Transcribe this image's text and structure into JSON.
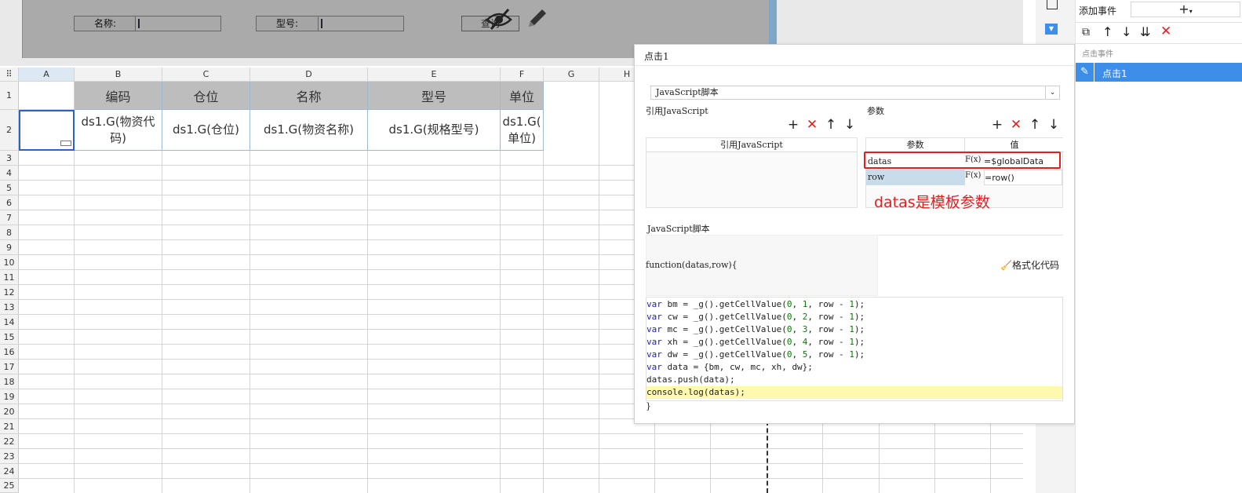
{
  "form": {
    "name_label": "名称:",
    "model_label": "型号:",
    "query_button": "查询"
  },
  "grid": {
    "columns": [
      "A",
      "B",
      "C",
      "D",
      "E",
      "F",
      "G",
      "H"
    ],
    "rows": [
      "1",
      "2",
      "3",
      "4",
      "5",
      "6",
      "7",
      "8",
      "9",
      "10",
      "11",
      "12",
      "13",
      "14",
      "15",
      "16",
      "17",
      "18",
      "19",
      "20",
      "21",
      "22",
      "23",
      "24",
      "25"
    ],
    "header_cells": [
      "编码",
      "仓位",
      "名称",
      "型号",
      "单位"
    ],
    "data_cells": [
      "ds1.G(物资代\n码)",
      "ds1.G(仓位)",
      "ds1.G(物资名称)",
      "ds1.G(规格型号)",
      "ds1.G(\n单位)"
    ]
  },
  "dialog": {
    "title": "点击1",
    "type_select": "JavaScript脚本",
    "ref_js_section": "引用JavaScript",
    "ref_js_column": "引用JavaScript",
    "params_section": "参数",
    "params_col_name": "参数",
    "params_col_value": "值",
    "params": [
      {
        "name": "datas",
        "fx": "F(x)",
        "value": "=$globalData"
      },
      {
        "name": "row",
        "fx": "F(x)",
        "value": "=row()"
      }
    ],
    "annotation": "datas是模板参数",
    "script_section": "JavaScript脚本",
    "function_signature": "function(datas,row){",
    "format_button": "格式化代码",
    "closing_brace": "}",
    "code_lines": [
      "var bm = _g().getCellValue(0, 1, row - 1);",
      "var cw = _g().getCellValue(0, 2, row - 1);",
      "var mc = _g().getCellValue(0, 3, row - 1);",
      "var xh = _g().getCellValue(0, 4, row - 1);",
      "var dw = _g().getCellValue(0, 5, row - 1);",
      "var data = {bm, cw, mc, xh, dw};",
      "datas.push(data);",
      "console.log(datas);"
    ]
  },
  "events_panel": {
    "add_event_label": "添加事件",
    "section_label": "点击事件",
    "selected_event": "点击1"
  },
  "colors": {
    "highlight_red": "#e02020",
    "selected_blue": "#3d8ee8",
    "code_highlight": "#fff9b0"
  }
}
